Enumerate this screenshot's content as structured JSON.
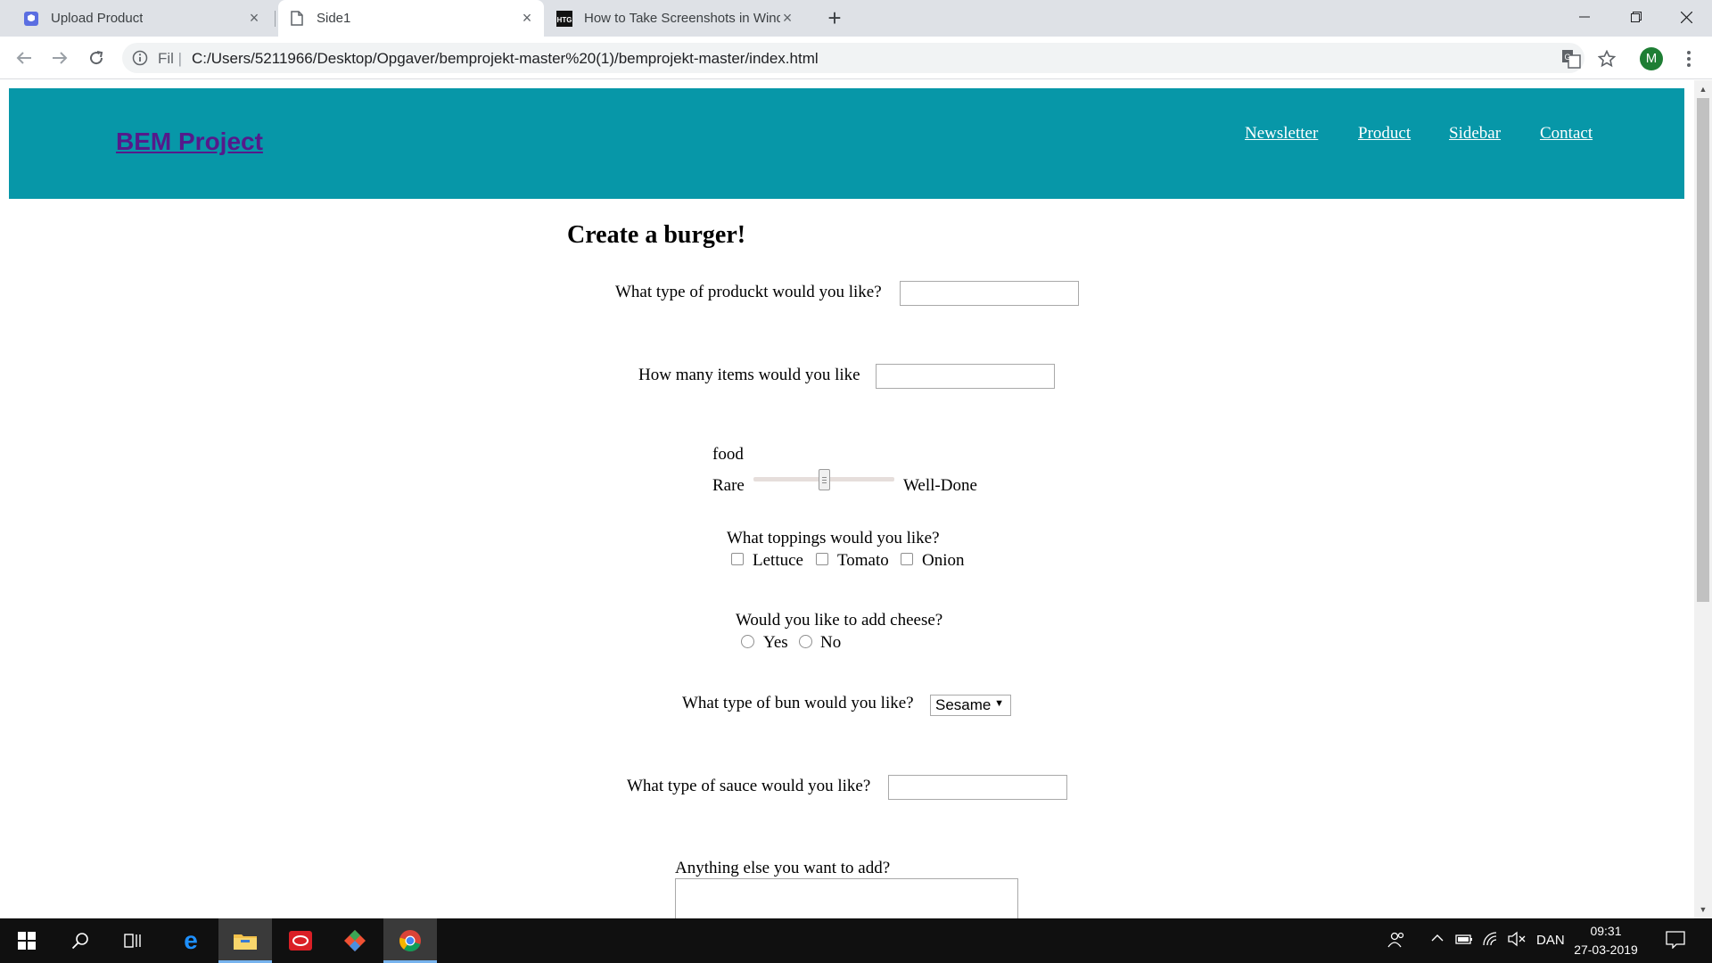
{
  "browser": {
    "tabs": [
      {
        "title": "Upload Product",
        "icon": "shield-icon"
      },
      {
        "title": "Side1",
        "icon": "document-icon",
        "active": true
      },
      {
        "title": "How to Take Screenshots in Windows",
        "icon": "htg-icon"
      }
    ],
    "address": {
      "scheme_label": "Fil",
      "url": "C:/Users/5211966/Desktop/Opgaver/bemprojekt-master%20(1)/bemprojekt-master/index.html"
    },
    "profile_initial": "M"
  },
  "page": {
    "logo": "BEM Project",
    "nav": [
      "Newsletter",
      "Product",
      "Sidebar",
      "Contact"
    ],
    "form": {
      "title": "Create a burger!",
      "product_label": "What type of produckt would you like?",
      "items_label": "How many items would you like",
      "slider_caption": "food",
      "slider_min_label": "Rare",
      "slider_max_label": "Well-Done",
      "slider_value": 0.5,
      "toppings_label": "What toppings would you like?",
      "toppings": [
        "Lettuce",
        "Tomato",
        "Onion"
      ],
      "cheese_label": "Would you like to add cheese?",
      "cheese_options": [
        "Yes",
        "No"
      ],
      "bun_label": "What type of bun would you like?",
      "bun_selected": "Sesame",
      "sauce_label": "What type of sauce would you like?",
      "extra_label": "Anything else you want to add?"
    }
  },
  "taskbar": {
    "language": "DAN",
    "time": "09:31",
    "date": "27-03-2019"
  },
  "colors": {
    "header_bg": "#0797a8",
    "logo_link": "#551a8b",
    "taskbar_bg": "#101010"
  }
}
